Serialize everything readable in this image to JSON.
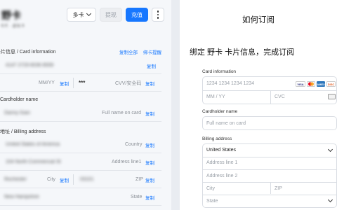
{
  "left": {
    "card_name": "野卡",
    "card_sub": "卡片 · 虚拟卡",
    "toolbar": {
      "multi_card": "多卡",
      "withdraw": "提现",
      "topup": "充值"
    },
    "card_section": {
      "title": "卡片信息 / Card information",
      "copy_all": "复制全部",
      "bind_card": "绑卡提醒"
    },
    "card_number": {
      "value": "4147 2729 6036 8939",
      "copy": "复制"
    },
    "expiry": {
      "placeholder": "MM/YY",
      "copy": "复制"
    },
    "cvv": {
      "value": "***",
      "placeholder": "CVV/安全码",
      "copy": "复制"
    },
    "holder_section": {
      "title": "Cardholder name"
    },
    "holder": {
      "value": "Danny Gian",
      "placeholder": "Full name on card",
      "copy": "复制"
    },
    "billing_section": {
      "title": "账单地址 / Billing address"
    },
    "country": {
      "value": "United States of America",
      "placeholder": "Country",
      "copy": "复制"
    },
    "address1": {
      "value": "104 North Commercial St",
      "placeholder": "Address line1",
      "copy": "复制"
    },
    "city": {
      "value": "Rochester",
      "placeholder": "City",
      "copy": "复制"
    },
    "zip": {
      "value": "03101",
      "placeholder": "ZIP",
      "copy": "复制"
    },
    "state": {
      "value": "New Hampshire",
      "placeholder": "State",
      "copy": "复制"
    }
  },
  "right": {
    "title": "如何订阅",
    "subtitle": "绑定 野卡 卡片信息，完成订阅",
    "card_info_label": "Card information",
    "card_number_placeholder": "1234 1234 1234 1234",
    "expiry_placeholder": "MM / YY",
    "cvc_placeholder": "CVC",
    "brands": {
      "visa": "VISA",
      "amex": "AMEX",
      "discover": "DISC"
    },
    "holder_label": "Cardholder name",
    "holder_placeholder": "Full name on card",
    "billing_label": "Billing address",
    "country_value": "United States",
    "address1_placeholder": "Address line 1",
    "address2_placeholder": "Address line 2",
    "city_placeholder": "City",
    "zip_placeholder": "ZIP",
    "state_placeholder": "State"
  },
  "colors": {
    "accent": "#1677ff",
    "visa": "#1a1f71",
    "mastercard_red": "#eb001b",
    "mastercard_yellow": "#f79e1b",
    "amex": "#2e77bc"
  }
}
